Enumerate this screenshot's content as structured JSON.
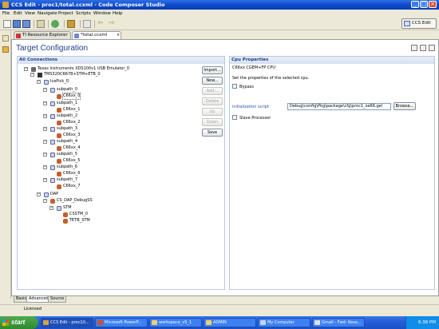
{
  "window": {
    "title": "CCS Edit - proc1/total.ccxml - Code Composer Studio"
  },
  "menu": [
    "File",
    "Edit",
    "View",
    "Navigate",
    "Project",
    "Scripts",
    "Window",
    "Help"
  ],
  "perspective": {
    "label": "CCS Edit"
  },
  "tabs": [
    {
      "label": "TI Resource Explorer"
    },
    {
      "label": "*total.ccxml"
    }
  ],
  "page": {
    "title": "Target Configuration"
  },
  "connections": {
    "heading": "All Connections",
    "tree": [
      {
        "label": "Texas Instruments XDS100v1 USB Emulator_0",
        "icon": "emulator-icon"
      },
      {
        "label": "TMS320C6678+STM+ETB_0",
        "icon": "board-icon"
      },
      {
        "label": "IcePick_D",
        "icon": "path-icon"
      },
      {
        "label": "subpath_0",
        "icon": "path-icon"
      },
      {
        "label": "C66xx_0",
        "icon": "cpu-icon"
      },
      {
        "label": "subpath_1",
        "icon": "path-icon"
      },
      {
        "label": "C66xx_1",
        "icon": "cpu-icon"
      },
      {
        "label": "subpath_2",
        "icon": "path-icon"
      },
      {
        "label": "C66xx_2",
        "icon": "cpu-icon"
      },
      {
        "label": "subpath_3",
        "icon": "path-icon"
      },
      {
        "label": "C66xx_3",
        "icon": "cpu-icon"
      },
      {
        "label": "subpath_4",
        "icon": "path-icon"
      },
      {
        "label": "C66xx_4",
        "icon": "cpu-icon"
      },
      {
        "label": "subpath_5",
        "icon": "path-icon"
      },
      {
        "label": "C66xx_5",
        "icon": "cpu-icon"
      },
      {
        "label": "subpath_6",
        "icon": "path-icon"
      },
      {
        "label": "C66xx_6",
        "icon": "cpu-icon"
      },
      {
        "label": "subpath_7",
        "icon": "path-icon"
      },
      {
        "label": "C66xx_7",
        "icon": "cpu-icon"
      },
      {
        "label": "DAP",
        "icon": "path-icon"
      },
      {
        "label": "CS_DAP_DebugSS",
        "icon": "cpu-icon"
      },
      {
        "label": "STM",
        "icon": "path-icon"
      },
      {
        "label": "CSSTM_0",
        "icon": "cpu-icon"
      },
      {
        "label": "TETB_STM",
        "icon": "cpu-icon"
      }
    ],
    "buttons": {
      "import": "Import...",
      "new": "New...",
      "add": "Add...",
      "delete": "Delete",
      "up": "Up",
      "down": "Down",
      "save": "Save"
    }
  },
  "cpu_properties": {
    "heading": "Cpu Properties",
    "cpu_name": "C66xx CGEM+FP CPU",
    "description": "Set the properties of the selected cpu.",
    "bypass_label": "Bypass",
    "bypass_checked": false,
    "init_script_label": "initialization script",
    "init_script_value": "Debug\\config\\Pkg\\package\\cfg\\proc1_xe66.gel",
    "browse_label": "Browse...",
    "slave_label": "Slave Processor",
    "slave_checked": false
  },
  "bottom_tabs": [
    "Basic",
    "Advanced",
    "Source"
  ],
  "status": {
    "text": "Licensed"
  },
  "taskbar": {
    "start": "start",
    "items": [
      "CCS Edit - proc1/t...",
      "Microsoft PowerP...",
      "workspace_v5_1",
      "ADMIN",
      "My Computer",
      "Gmail - Fwd: Kesa..."
    ],
    "clock": "6:38 PM"
  }
}
